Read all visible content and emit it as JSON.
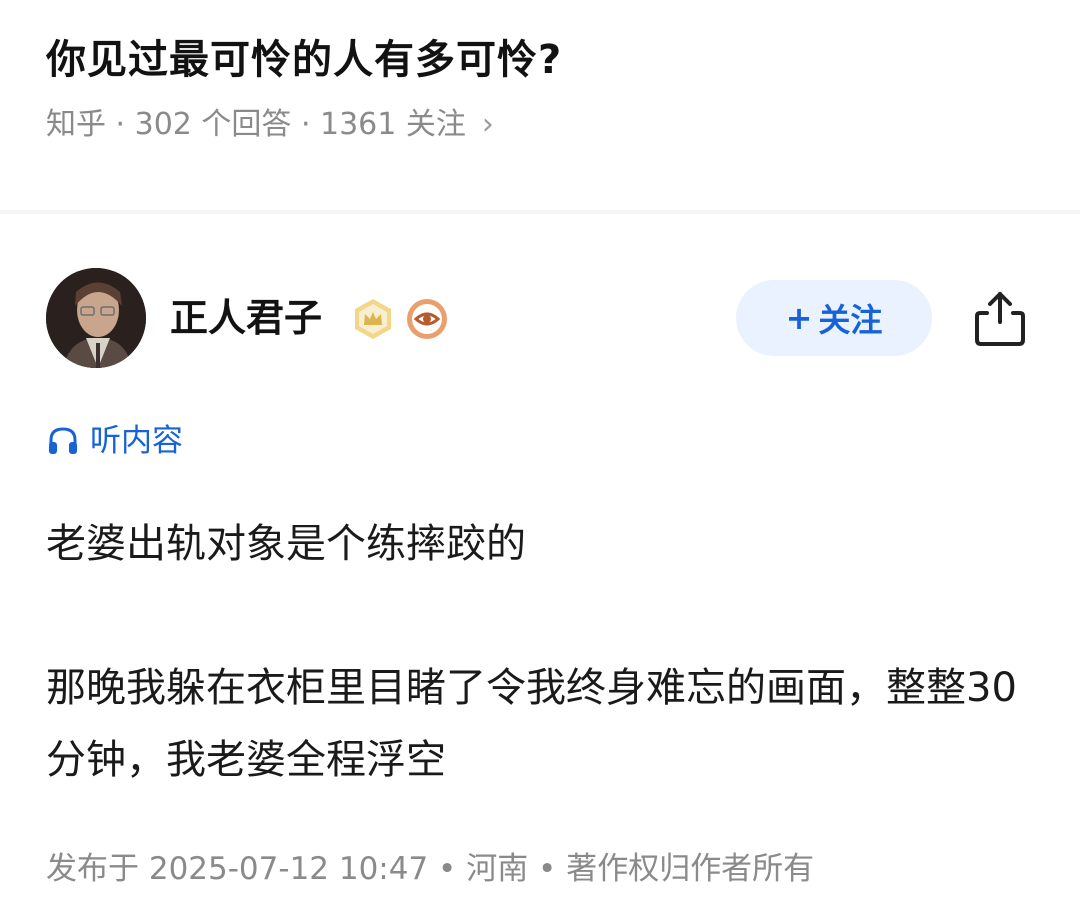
{
  "question": {
    "title": "你见过最可怜的人有多可怜?",
    "meta": "知乎 · 302 个回答 · 1361 关注",
    "chevron": "›"
  },
  "author": {
    "name": "正人君子",
    "follow_label": "关注",
    "follow_prefix": "+",
    "share_icon": "share-icon"
  },
  "listen": {
    "label": "听内容",
    "icon": "headphones-icon"
  },
  "answer": {
    "paragraphs": [
      "老婆出轨对象是个练摔跤的",
      "那晚我躲在衣柜里目睹了令我终身难忘的画面，整整30分钟，我老婆全程浮空"
    ]
  },
  "footer": {
    "meta": "发布于 2025-07-12 10:47 • 河南 • 著作权归作者所有"
  },
  "colors": {
    "accent": "#1763d6",
    "follow_bg": "#eaf2ff",
    "meta_gray": "#8a8a8a"
  }
}
